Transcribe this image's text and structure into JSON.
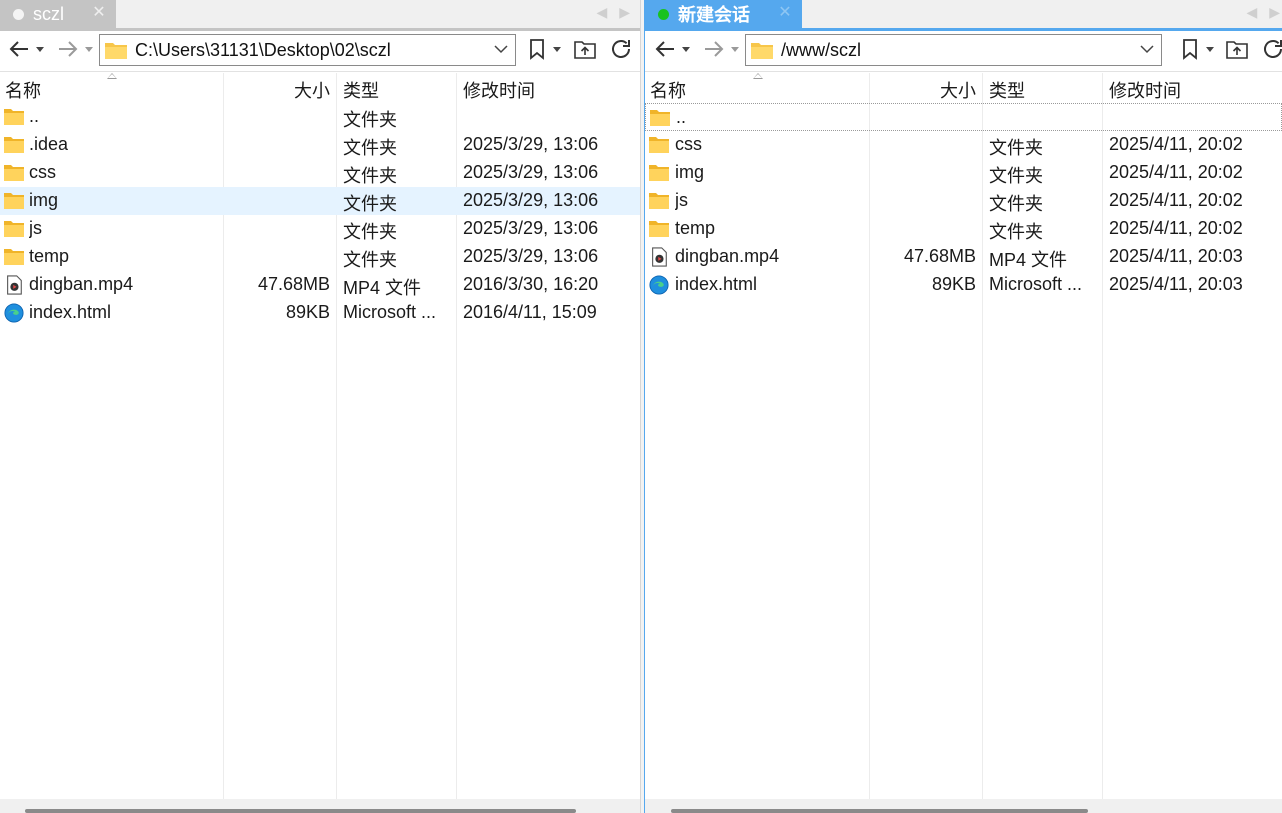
{
  "left": {
    "tab": {
      "title": "sczl",
      "close": "✕"
    },
    "path": "C:\\Users\\31131\\Desktop\\02\\sczl",
    "columns": {
      "name": "名称",
      "size": "大小",
      "type": "类型",
      "modified": "修改时间"
    },
    "files": [
      {
        "name": "..",
        "size": "",
        "type": "文件夹",
        "modified": "",
        "icon": "folder-icon"
      },
      {
        "name": ".idea",
        "size": "",
        "type": "文件夹",
        "modified": "2025/3/29, 13:06",
        "icon": "folder-icon"
      },
      {
        "name": "css",
        "size": "",
        "type": "文件夹",
        "modified": "2025/3/29, 13:06",
        "icon": "folder-icon"
      },
      {
        "name": "img",
        "size": "",
        "type": "文件夹",
        "modified": "2025/3/29, 13:06",
        "icon": "folder-icon"
      },
      {
        "name": "js",
        "size": "",
        "type": "文件夹",
        "modified": "2025/3/29, 13:06",
        "icon": "folder-icon"
      },
      {
        "name": "temp",
        "size": "",
        "type": "文件夹",
        "modified": "2025/3/29, 13:06",
        "icon": "folder-icon"
      },
      {
        "name": "dingban.mp4",
        "size": "47.68MB",
        "type": "MP4 文件",
        "modified": "2016/3/30, 16:20",
        "icon": "video-file-icon"
      },
      {
        "name": "index.html",
        "size": "89KB",
        "type": "Microsoft ...",
        "modified": "2016/4/11, 15:09",
        "icon": "edge-browser-icon"
      }
    ]
  },
  "right": {
    "tab": {
      "title": "新建会话",
      "close": "✕"
    },
    "path": "/www/sczl",
    "columns": {
      "name": "名称",
      "size": "大小",
      "type": "类型",
      "modified": "修改时间"
    },
    "files": [
      {
        "name": "..",
        "size": "",
        "type": "",
        "modified": "",
        "icon": "folder-icon"
      },
      {
        "name": "css",
        "size": "",
        "type": "文件夹",
        "modified": "2025/4/11, 20:02",
        "icon": "folder-icon"
      },
      {
        "name": "img",
        "size": "",
        "type": "文件夹",
        "modified": "2025/4/11, 20:02",
        "icon": "folder-icon"
      },
      {
        "name": "js",
        "size": "",
        "type": "文件夹",
        "modified": "2025/4/11, 20:02",
        "icon": "folder-icon"
      },
      {
        "name": "temp",
        "size": "",
        "type": "文件夹",
        "modified": "2025/4/11, 20:02",
        "icon": "folder-icon"
      },
      {
        "name": "dingban.mp4",
        "size": "47.68MB",
        "type": "MP4 文件",
        "modified": "2025/4/11, 20:03",
        "icon": "video-file-icon"
      },
      {
        "name": "index.html",
        "size": "89KB",
        "type": "Microsoft ...",
        "modified": "2025/4/11, 20:03",
        "icon": "edge-browser-icon"
      }
    ]
  },
  "colors": {
    "active_tab": "#55a8ee",
    "inactive_tab": "#c4c4c4",
    "connected_dot": "#19c21e",
    "selected_row": "#e5f3ff",
    "folder": "#f7c64a"
  }
}
